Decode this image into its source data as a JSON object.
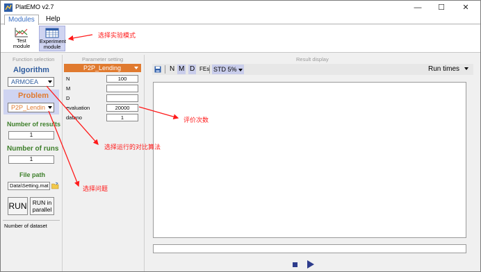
{
  "window": {
    "title": "PlatEMO v2.7",
    "controls": [
      "—",
      "☐",
      "✕"
    ]
  },
  "menu": {
    "tabs": [
      "Modules",
      "Help"
    ]
  },
  "ribbon": {
    "test_module": [
      "Test",
      "module"
    ],
    "experiment_module": [
      "Experiment",
      "module"
    ]
  },
  "left_panel": {
    "title": "Function selection",
    "algorithm_label": "Algorithm",
    "algorithm_value": "ARMOEA",
    "problem_label": "Problem",
    "problem_value": "P2P_Lendin",
    "results_label": "Number of results",
    "results_value": "1",
    "runs_label": "Number of runs",
    "runs_value": "1",
    "path_label": "File path",
    "path_value": "Data\\Setting.mat",
    "run_button": "RUN",
    "parallel_button": [
      "RUN in",
      "parallel"
    ],
    "dataset_label": "Number of dataset"
  },
  "param_panel": {
    "title": "Parameter setting",
    "problem_header": "P2P_Lending",
    "params": [
      {
        "name": "N",
        "value": "100"
      },
      {
        "name": "M",
        "value": ""
      },
      {
        "name": "D",
        "value": ""
      },
      {
        "name": "evaluation",
        "value": "20000"
      },
      {
        "name": "datano",
        "value": "1"
      }
    ]
  },
  "result_panel": {
    "title": "Result display",
    "toolbar": {
      "n": "N",
      "m": "M",
      "d": "D",
      "fes": "FEs",
      "std": "STD",
      "pct": "5%"
    },
    "run_times": "Run times"
  },
  "annotations": {
    "experiment_mode": "选择实验模式",
    "eval_count": "评价次数",
    "compare_algorithm": "选择运行的对比算法",
    "select_problem": "选择问题"
  },
  "colors": {
    "annotation": "#ff1a1a",
    "problem_header": "#e07a2f",
    "algorithm": "#2f5c9e",
    "green_label": "#3d7f2a"
  }
}
